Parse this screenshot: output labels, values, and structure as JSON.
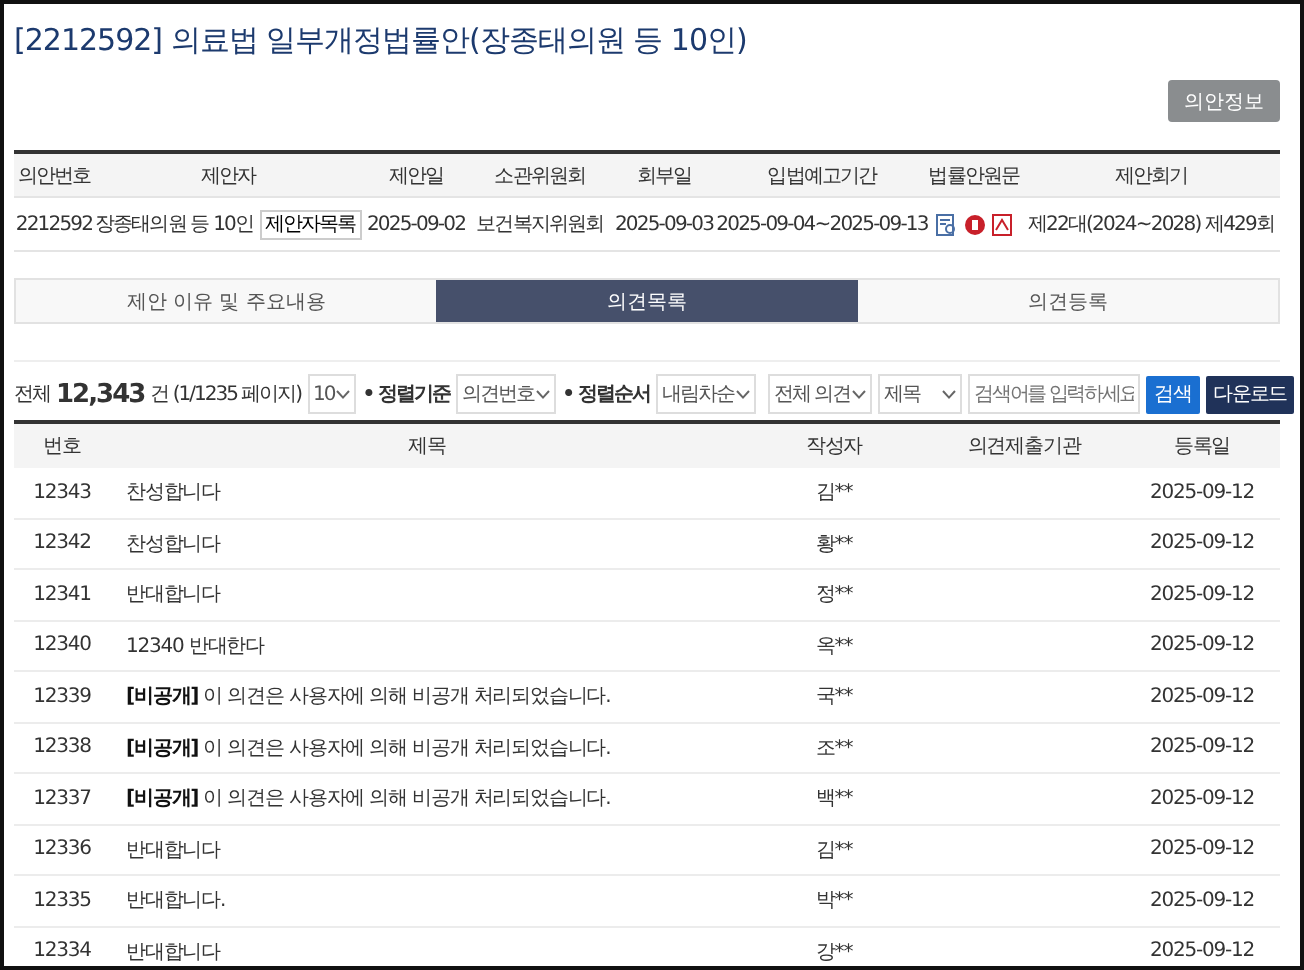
{
  "title": "[2212592] 의료법 일부개정법률안(장종태의원 등 10인)",
  "info_button": "의안정보",
  "bill_table": {
    "columns": [
      "의안번호",
      "제안자",
      "제안일",
      "소관위원회",
      "회부일",
      "입법예고기간",
      "법률안원문",
      "제안회기"
    ],
    "row": {
      "bill_no": "2212592",
      "proposer": "장종태의원 등 10인",
      "proposer_button": "제안자목록",
      "proposed_date": "2025-09-02",
      "committee": "보건복지위원회",
      "referral_date": "2025-09-03",
      "notice_period": "2025-09-04~2025-09-13",
      "session": "제22대(2024~2028) 제429회"
    }
  },
  "tabs": [
    {
      "label": "제안 이유 및 주요내용",
      "selected": false
    },
    {
      "label": "의견목록",
      "selected": true
    },
    {
      "label": "의견등록",
      "selected": false
    }
  ],
  "toolbar": {
    "total_label": "전체",
    "total_count": "12,343",
    "total_unit": "건 (1/1235 페이지)",
    "page_size": "10",
    "sort_by_label": "• 정렬기준",
    "sort_by": "의견번호",
    "sort_order_label": "• 정렬순서",
    "sort_order": "내림차순",
    "scope": "전체 의견",
    "field": "제목",
    "search_placeholder": "검색어를 입력하세요",
    "search_button": "검색",
    "download_button": "다운로드"
  },
  "list": {
    "columns": [
      "번호",
      "제목",
      "작성자",
      "의견제출기관",
      "등록일"
    ],
    "rows": [
      {
        "no": "12343",
        "title": "찬성합니다",
        "author": "김**",
        "date": "2025-09-12"
      },
      {
        "no": "12342",
        "title": "찬성합니다",
        "author": "황**",
        "date": "2025-09-12"
      },
      {
        "no": "12341",
        "title": "반대합니다",
        "author": "정**",
        "date": "2025-09-12"
      },
      {
        "no": "12340",
        "title": "12340 반대한다",
        "author": "옥**",
        "date": "2025-09-12"
      },
      {
        "no": "12339",
        "title": "**[비공개]** 이 의견은 사용자에 의해 비공개 처리되었습니다.",
        "author": "국**",
        "date": "2025-09-12"
      },
      {
        "no": "12338",
        "title": "**[비공개]** 이 의견은 사용자에 의해 비공개 처리되었습니다.",
        "author": "조**",
        "date": "2025-09-12"
      },
      {
        "no": "12337",
        "title": "**[비공개]** 이 의견은 사용자에 의해 비공개 처리되었습니다.",
        "author": "백**",
        "date": "2025-09-12"
      },
      {
        "no": "12336",
        "title": "반대합니다",
        "author": "김**",
        "date": "2025-09-12"
      },
      {
        "no": "12335",
        "title": "반대합니다.",
        "author": "박**",
        "date": "2025-09-12"
      },
      {
        "no": "12334",
        "title": "반대합니다",
        "author": "강**",
        "date": "2025-09-12"
      }
    ]
  }
}
